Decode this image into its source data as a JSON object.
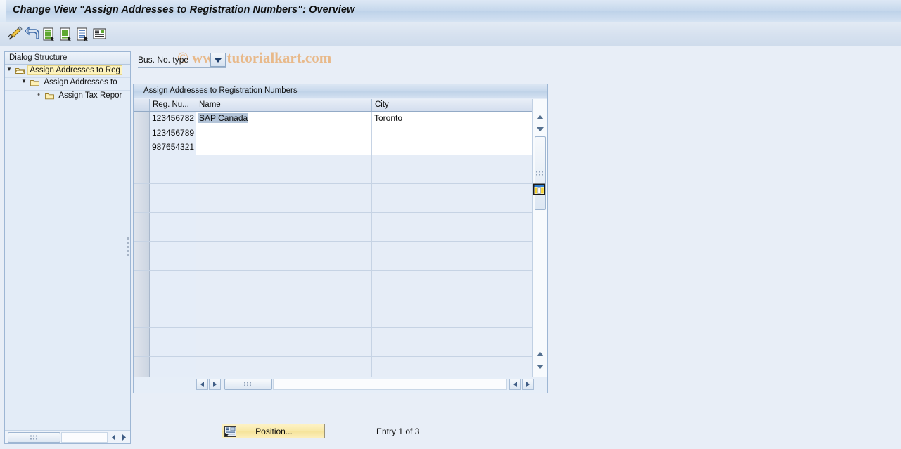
{
  "window": {
    "title": "Change View \"Assign Addresses to Registration Numbers\": Overview"
  },
  "watermark": {
    "text": "© www.tutorialkart.com"
  },
  "toolbar": {
    "buttons": [
      {
        "name": "pencil-edit-icon",
        "tooltip": "Display/Change"
      },
      {
        "name": "undo-arrow-icon",
        "tooltip": "Back"
      },
      {
        "name": "new-entries-icon",
        "tooltip": "New Entries"
      },
      {
        "name": "copy-as-icon",
        "tooltip": "Copy As..."
      },
      {
        "name": "delete-entry-icon",
        "tooltip": "Delete"
      },
      {
        "name": "details-icon",
        "tooltip": "Details"
      }
    ]
  },
  "tree": {
    "header": "Dialog Structure",
    "items": [
      {
        "label": "Assign Addresses to Reg",
        "level": 0,
        "expander": "expanded",
        "selected": true
      },
      {
        "label": "Assign Addresses to",
        "level": 1,
        "expander": "expanded",
        "selected": false
      },
      {
        "label": "Assign Tax Repor",
        "level": 2,
        "expander": "leaf",
        "selected": false
      }
    ]
  },
  "filter": {
    "label": "Bus. No. type",
    "value": "",
    "dropdown_icon": "chevron-down-icon"
  },
  "table": {
    "title": "Assign Addresses to Registration Numbers",
    "columns": [
      {
        "key": "select",
        "label": ""
      },
      {
        "key": "regno",
        "label": "Reg. Nu..."
      },
      {
        "key": "name",
        "label": "Name"
      },
      {
        "key": "city",
        "label": "City"
      }
    ],
    "column_settings_icon": "table-settings-icon",
    "rows": [
      {
        "regno": "123456782",
        "name": "SAP Canada",
        "city": "Toronto",
        "selected": true,
        "name_highlighted": true
      },
      {
        "regno": "123456789",
        "name": "",
        "city": "",
        "selected": false,
        "name_highlighted": false
      },
      {
        "regno": "987654321",
        "name": "",
        "city": "",
        "selected": false,
        "name_highlighted": false
      }
    ],
    "empty_row_count": 16,
    "vscroll": {
      "up_icon": "scroll-up-icon",
      "down_icon": "scroll-down-icon"
    },
    "hscroll": {
      "left_icon": "scroll-left-icon",
      "right_icon": "scroll-right-icon"
    }
  },
  "footer": {
    "position_button": {
      "label": "Position...",
      "icon": "position-icon"
    },
    "entry_status": "Entry 1 of 3"
  },
  "colors": {
    "app_background": "#e8eef7",
    "title_bar": "#c6d8ec",
    "tree_selection": "#fdf3bd",
    "cell_selection": "#b3c4d8",
    "button_yellow": "#f8e9a8",
    "watermark": "#e8b98a"
  }
}
